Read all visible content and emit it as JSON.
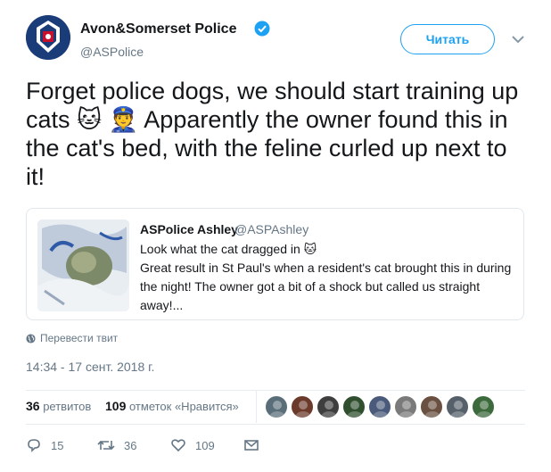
{
  "author": {
    "name": "Avon&Somerset Police",
    "handle": "@ASPolice",
    "verified": true
  },
  "follow_button": {
    "label": "Читать"
  },
  "tweet": {
    "text": "Forget police dogs, we should start training up cats 🐱 👮 Apparently the owner found this in the cat's bed, with the feline curled up next to it!"
  },
  "quoted_tweet": {
    "author_name": "ASPolice Ashley",
    "author_handle": "@ASPAshley",
    "text_line1": "Look what the cat dragged in 🐱",
    "text_body": "Great result in St Paul's when a resident's cat brought this in during the night! The owner got a bit of a shock but called us straight away!..."
  },
  "translate_label": "Перевести твит",
  "timestamp": "14:34 - 17 сент. 2018 г.",
  "stats": {
    "retweets_count": "36",
    "retweets_label": "ретвитов",
    "likes_count": "109",
    "likes_label": "отметок «Нравится»"
  },
  "liker_avatars": [
    "#5a6e7a",
    "#6b3a2a",
    "#3e3e3e",
    "#2f4f2f",
    "#4a5a7a",
    "#7a7a7a",
    "#6a5040",
    "#55606a",
    "#3c6a3c"
  ],
  "actions": {
    "reply_count": "15",
    "retweet_count": "36",
    "like_count": "109"
  },
  "colors": {
    "accent": "#1da1f2",
    "muted_text": "#657786",
    "border": "#e1e8ed"
  },
  "icons": [
    "police-crest-icon",
    "verified-badge-icon",
    "chevron-down-icon",
    "globe-icon",
    "reply-icon",
    "retweet-icon",
    "heart-icon",
    "envelope-icon"
  ]
}
